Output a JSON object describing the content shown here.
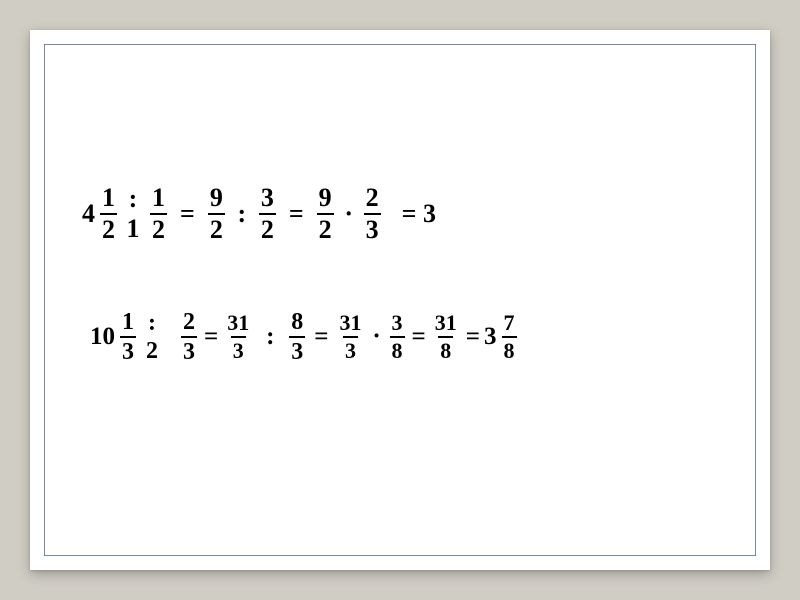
{
  "eq1": {
    "t1_whole": "4",
    "t1_num": "1",
    "t1_den": "2",
    "t1_stack_top": ":",
    "t1_stack_bot": "1",
    "f1_num": "1",
    "f1_den": "2",
    "eq_a": "=",
    "f2_num": "9",
    "f2_den": "2",
    "op_a": ":",
    "f3_num": "3",
    "f3_den": "2",
    "eq_b": "=",
    "f4_num": "9",
    "f4_den": "2",
    "op_b": "·",
    "f5_num": "2",
    "f5_den": "3",
    "eq_c": "= 3"
  },
  "eq2": {
    "t1_whole": "10",
    "t1_num": "1",
    "t1_den": "3",
    "t1_stack_top": ":",
    "t1_stack_bot": "2",
    "f1_num": "2",
    "f1_den": "3",
    "eq_a": "=",
    "f2_num": "31",
    "f2_den": "3",
    "op_a": ":",
    "f3_num": "8",
    "f3_den": "3",
    "eq_b": "=",
    "f4_num": "31",
    "f4_den": "3",
    "op_b": "·",
    "f5_num": "3",
    "f5_den": "8",
    "eq_c": "=",
    "f6_num": "31",
    "f6_den": "8",
    "eq_d": "=",
    "res_whole": "3",
    "res_num": "7",
    "res_den": "8"
  }
}
